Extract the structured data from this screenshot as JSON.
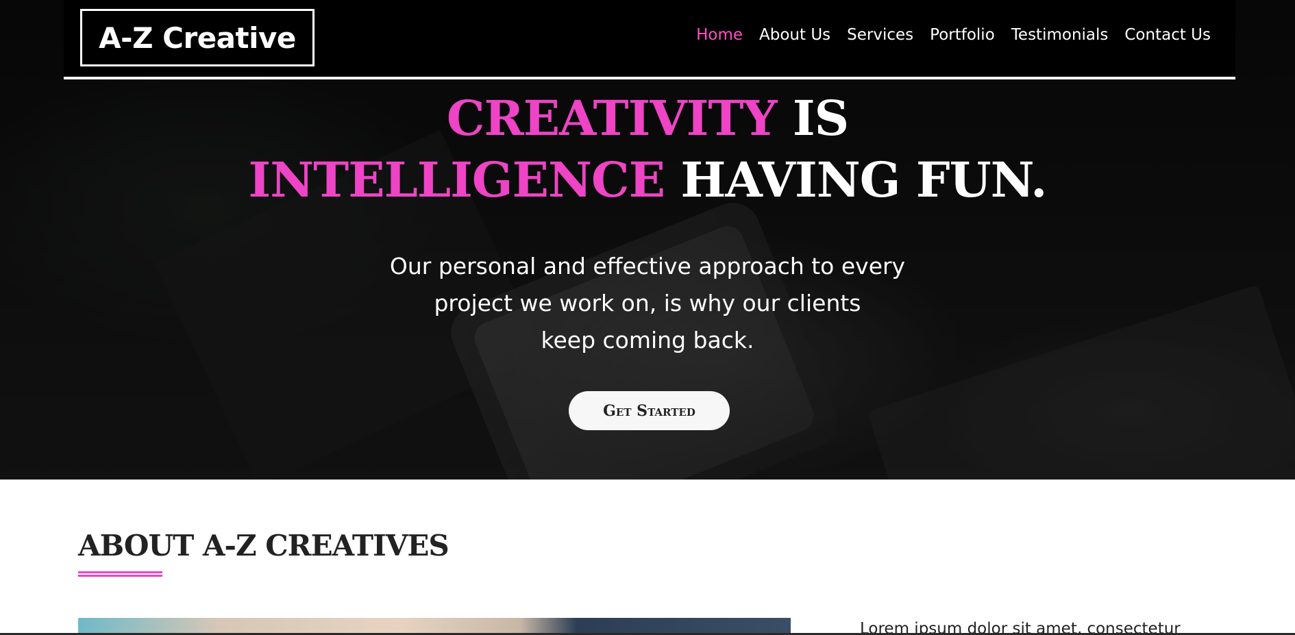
{
  "brand": {
    "logo": "A-Z Creative"
  },
  "nav": {
    "items": [
      {
        "label": "Home",
        "active": true
      },
      {
        "label": "About Us",
        "active": false
      },
      {
        "label": "Services",
        "active": false
      },
      {
        "label": "Portfolio",
        "active": false
      },
      {
        "label": "Testimonials",
        "active": false
      },
      {
        "label": "Contact Us",
        "active": false
      }
    ]
  },
  "hero": {
    "headline_line1_accent": "CREATIVITY",
    "headline_line1_rest": " IS",
    "headline_line2_accent": "INTELLIGENCE",
    "headline_line2_rest": " HAVING FUN.",
    "subtext_line1": "Our personal and effective approach to every",
    "subtext_line2": "project we work on, is why our clients",
    "subtext_line3": "keep coming back.",
    "cta_label": "Get Started"
  },
  "about": {
    "title": "ABOUT A-Z CREATIVES",
    "text_preview": "Lorem ipsum dolor sit amet, consectetur"
  },
  "colors": {
    "accent": "#ee44c5",
    "nav_background": "#000000",
    "text_dark": "#222222"
  }
}
